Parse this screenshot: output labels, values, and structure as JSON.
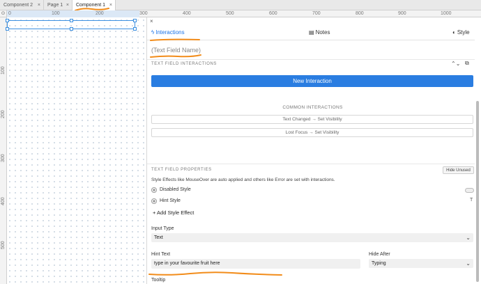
{
  "tabs": [
    {
      "label": "Component 2",
      "active": false
    },
    {
      "label": "Page 1",
      "active": false
    },
    {
      "label": "Component 1",
      "active": true
    }
  ],
  "close_glyph": "×",
  "ruler": {
    "h_labels": [
      "0",
      "100",
      "200",
      "300",
      "400",
      "500",
      "600",
      "700",
      "800",
      "900",
      "1000"
    ],
    "v_labels": [
      "100",
      "200",
      "300",
      "400",
      "500"
    ]
  },
  "panel": {
    "close_glyph": "×",
    "tabs": [
      {
        "label": "Interactions",
        "icon": "lightning-icon",
        "active": true
      },
      {
        "label": "Notes",
        "icon": "notes-icon",
        "active": false
      },
      {
        "label": "Style",
        "icon": "style-icon",
        "active": false
      }
    ],
    "element_name": "(Text Field Name)",
    "interactions_header": "TEXT FIELD INTERACTIONS",
    "new_interaction_label": "New Interaction",
    "common_header": "COMMON INTERACTIONS",
    "common_items": [
      "Text Changed → Set Visibility",
      "Lost Focus → Set Visibility"
    ],
    "properties_header": "TEXT FIELD PROPERTIES",
    "hide_unused_label": "Hide Unused",
    "style_effects_note": "Style Effects like MouseOver are auto applied and others like Error are set with interactions.",
    "style_effects": [
      "Disabled Style",
      "Hint Style"
    ],
    "hint_style_mark": "T",
    "add_style_effect_label": "+ Add Style Effect",
    "input_type_label": "Input Type",
    "input_type_value": "Text",
    "hint_text_label": "Hint Text",
    "hint_text_value": "type in your favourite fruit here",
    "hide_after_label": "Hide After",
    "hide_after_value": "Typing",
    "tooltip_label": "Tooltip"
  },
  "colors": {
    "accent": "#2a7de1",
    "annotation": "#f28c1a",
    "selection": "#3b8fe0"
  }
}
